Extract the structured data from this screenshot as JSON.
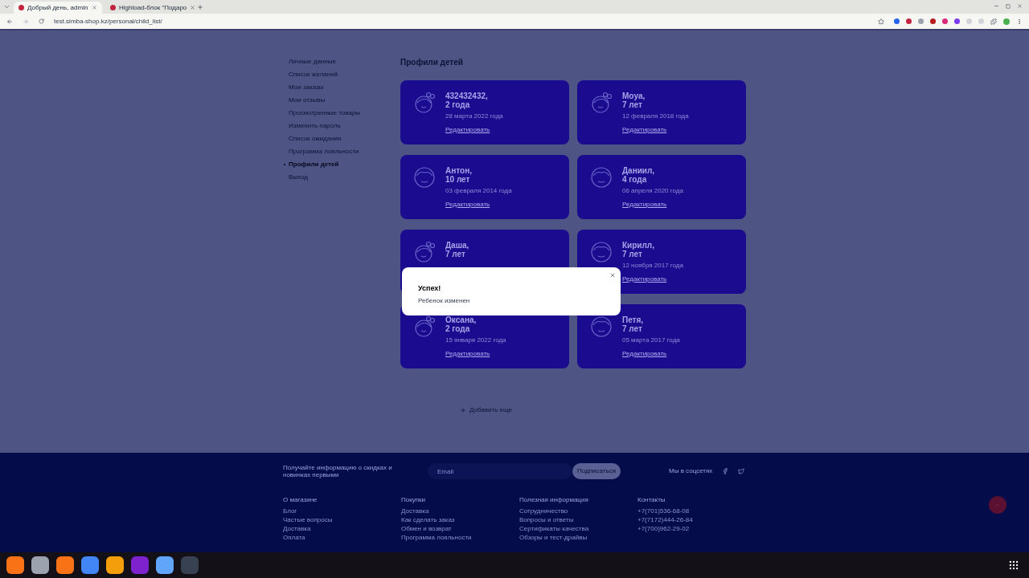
{
  "browser": {
    "tabs": [
      {
        "title": "Добрый день, admin",
        "selected": true
      },
      {
        "title": "Highload-блок \"Подаро",
        "selected": false
      }
    ],
    "url": "test.simba-shop.kz/personal/child_list/"
  },
  "sidebar": {
    "items": [
      {
        "label": "Личные данные",
        "selected": false
      },
      {
        "label": "Список желаний",
        "selected": false
      },
      {
        "label": "Мои заказы",
        "selected": false
      },
      {
        "label": "Мои отзывы",
        "selected": false
      },
      {
        "label": "Просмотренные товары",
        "selected": false
      },
      {
        "label": "Изменить пароль",
        "selected": false
      },
      {
        "label": "Список ожидания",
        "selected": false
      },
      {
        "label": "Программа лояльности",
        "selected": false
      },
      {
        "label": "Профили детей",
        "selected": true
      },
      {
        "label": "Выход",
        "selected": false
      }
    ]
  },
  "heading": "Профили детей",
  "children": [
    {
      "kind": "girl",
      "name": "432432432,",
      "age": "2 года",
      "date": "28 марта 2022 года",
      "edit": "Редактировать"
    },
    {
      "kind": "girl",
      "name": "Moya,",
      "age": "7 лет",
      "date": "12 февраля 2018 года",
      "edit": "Редактировать"
    },
    {
      "kind": "boy",
      "name": "Антон,",
      "age": "10 лет",
      "date": "03 февраля 2014 года",
      "edit": "Редактировать"
    },
    {
      "kind": "boy",
      "name": "Даниил,",
      "age": "4 года",
      "date": "06 апреля 2020 года",
      "edit": "Редактировать"
    },
    {
      "kind": "girl",
      "name": "Даша,",
      "age": "7 лет"
    },
    {
      "kind": "boy",
      "name": "Кирилл,",
      "age": "7 лет",
      "date": "12 ноября 2017 года",
      "edit": "Редактировать"
    },
    {
      "kind": "girl",
      "name": "Оксана,",
      "age": "2 года",
      "date": "15 января 2022 года",
      "edit": "Редактировать"
    },
    {
      "kind": "boy",
      "name": "Петя,",
      "age": "7 лет",
      "date": "05 марта 2017 года",
      "edit": "Редактировать"
    }
  ],
  "add_button": "Добавить еще",
  "modal": {
    "title": "Успех!",
    "message": "Ребенок изменен"
  },
  "footer": {
    "newsletter": "Получайте информацию о скидках и новинках первыми",
    "email_placeholder": "Email",
    "subscribe": "Подписаться",
    "social": "Мы в соцсетях",
    "columns": [
      {
        "title": "О магазине",
        "links": [
          "Блог",
          "Частые вопросы",
          "Доставка",
          "Оплата"
        ]
      },
      {
        "title": "Покупки",
        "links": [
          "Доставка",
          "Как сделать заказ",
          "Обмен и возврат",
          "Программа лояльности"
        ]
      },
      {
        "title": "Полезная информация",
        "links": [
          "Сотрудничество",
          "Вопросы и ответы",
          "Сертификаты качества",
          "Обзоры и тест-драйвы"
        ]
      },
      {
        "title": "Контакты",
        "links": [
          "+7(701)536-68-08",
          "+7(7172)444-26-84",
          "+7(700)962-29-02"
        ]
      }
    ]
  }
}
